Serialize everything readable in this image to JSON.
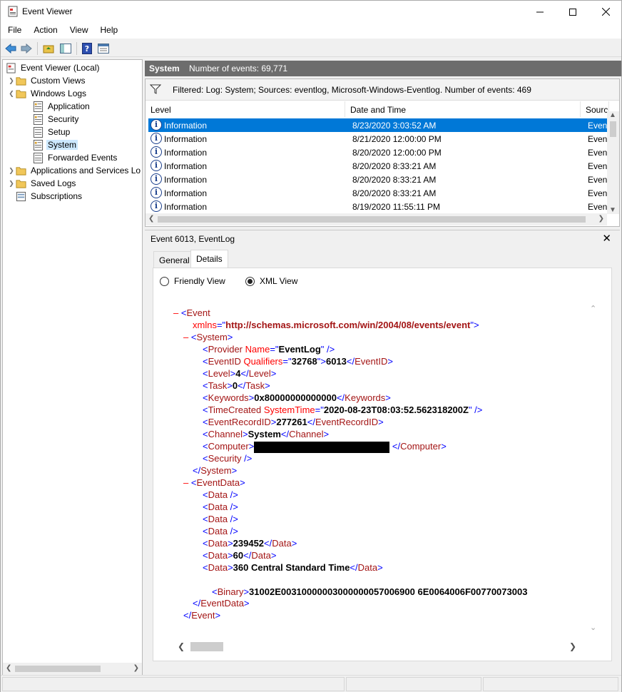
{
  "window": {
    "title": "Event Viewer"
  },
  "menu": [
    "File",
    "Action",
    "View",
    "Help"
  ],
  "tree": {
    "items": [
      {
        "label": "Event Viewer (Local)",
        "icon": "event-viewer-icon"
      },
      {
        "label": "Custom Views",
        "icon": "folder-icon"
      },
      {
        "label": "Windows Logs",
        "icon": "folder-icon"
      },
      {
        "label": "Application",
        "icon": "log-icon"
      },
      {
        "label": "Security",
        "icon": "log-icon"
      },
      {
        "label": "Setup",
        "icon": "log-icon"
      },
      {
        "label": "System",
        "icon": "log-icon"
      },
      {
        "label": "Forwarded Events",
        "icon": "log-icon"
      },
      {
        "label": "Applications and Services Lo",
        "icon": "folder-icon"
      },
      {
        "label": "Saved Logs",
        "icon": "folder-icon"
      },
      {
        "label": "Subscriptions",
        "icon": "subscriptions-icon"
      }
    ]
  },
  "pane": {
    "title": "System",
    "count": "Number of events: 69,771"
  },
  "filter": {
    "text": "Filtered: Log: System; Sources: eventlog, Microsoft-Windows-Eventlog. Number of events: 469"
  },
  "list": {
    "columns": [
      "Level",
      "Date and Time",
      "Source"
    ],
    "rows": [
      {
        "level": "Information",
        "date": "8/23/2020 3:03:52 AM",
        "source": "Eventl"
      },
      {
        "level": "Information",
        "date": "8/21/2020 12:00:00 PM",
        "source": "Eventl"
      },
      {
        "level": "Information",
        "date": "8/20/2020 12:00:00 PM",
        "source": "Eventl"
      },
      {
        "level": "Information",
        "date": "8/20/2020 8:33:21 AM",
        "source": "Eventl"
      },
      {
        "level": "Information",
        "date": "8/20/2020 8:33:21 AM",
        "source": "Eventl"
      },
      {
        "level": "Information",
        "date": "8/20/2020 8:33:21 AM",
        "source": "Eventl"
      },
      {
        "level": "Information",
        "date": "8/19/2020 11:55:11 PM",
        "source": "Eventl"
      }
    ]
  },
  "detail": {
    "title": "Event 6013, EventLog",
    "tabs": [
      "General",
      "Details"
    ],
    "radio_friendly": "Friendly View",
    "radio_xml": "XML View"
  },
  "xml": {
    "event_tag": "Event",
    "xmlns_attr": "xmlns",
    "xmlns_value": "http://schemas.microsoft.com/win/2004/08/events/event",
    "system_tag": "System",
    "provider_tag": "Provider",
    "provider_attr": "Name",
    "provider_value": "EventLog",
    "eventid_tag": "EventID",
    "eventid_attr": "Qualifiers",
    "eventid_qualifiers": "32768",
    "eventid_value": "6013",
    "level_tag": "Level",
    "level_value": "4",
    "task_tag": "Task",
    "task_value": "0",
    "keywords_tag": "Keywords",
    "keywords_value": "0x80000000000000",
    "timecreated_tag": "TimeCreated",
    "timecreated_attr": "SystemTime",
    "timecreated_value": "2020-08-23T08:03:52.562318200Z",
    "recordid_tag": "EventRecordID",
    "recordid_value": "277261",
    "channel_tag": "Channel",
    "channel_value": "System",
    "computer_tag": "Computer",
    "security_tag": "Security",
    "eventdata_tag": "EventData",
    "data_tag": "Data",
    "data_239452": "239452",
    "data_60": "60",
    "data_tz": "360 Central Standard Time",
    "binary_tag": "Binary",
    "binary_value": "31002E00310000003000000057006900 6E0064006F00770073003"
  }
}
